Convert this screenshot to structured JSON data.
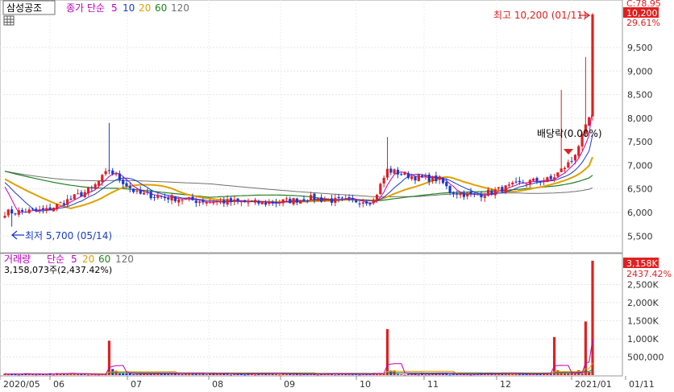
{
  "header": {
    "stock_name": "삼성공조",
    "price_ma_label": "종가 단순",
    "ma_periods": [
      "5",
      "10",
      "20",
      "60",
      "120"
    ],
    "volume_label": "거래량",
    "volume_ma_label": "단순",
    "volume_ma_periods": [
      "5",
      "20",
      "60",
      "120"
    ],
    "volume_readout": "3,158,073주(2,437.42%)"
  },
  "colors": {
    "up": "#e02020",
    "down": "#1a3cc8",
    "ma5": "#c000c0",
    "ma10": "#1a3cc8",
    "ma20": "#e0a000",
    "ma60": "#208020",
    "ma120": "#707070",
    "badge": "#e02020"
  },
  "price_axis": {
    "ticks": [
      "5,500",
      "6,000",
      "6,500",
      "7,000",
      "7,500",
      "8,000",
      "8,500",
      "9,000",
      "9,500"
    ],
    "right_top_clipped": "C:78.95",
    "last_price": "10,200",
    "change_pct": "29.61%"
  },
  "volume_axis": {
    "ticks": [
      "500,000",
      "1,000K",
      "1,500K",
      "2,000K",
      "2,500K"
    ],
    "last_volume": "3,158K",
    "change_pct": "2437.42%"
  },
  "x_axis": {
    "labels": [
      "2020/05",
      "06",
      "07",
      "08",
      "09",
      "10",
      "11",
      "12",
      "2021/01",
      "01/11"
    ]
  },
  "annotations": {
    "high": "최고 10,200 (01/11)",
    "low": "최저 5,700 (05/14)",
    "dividend": "배당락(0.00%)"
  },
  "chart_data": {
    "type": "candlestick",
    "title": "삼성공조",
    "period": "2020/05 - 2021/01/11 (daily)",
    "y_range": [
      5300,
      10200
    ],
    "volume_range": [
      0,
      3200000
    ],
    "highest": {
      "value": 10200,
      "date": "01/11"
    },
    "lowest": {
      "value": 5700,
      "date": "05/14"
    },
    "last": {
      "close": 10200,
      "change_pct": 29.61,
      "volume": 3158073,
      "volume_change_pct": 2437.42
    },
    "approx_close_path": [
      {
        "month": "2020/05",
        "close": 6000
      },
      {
        "month": "06",
        "close": 6700
      },
      {
        "month": "07",
        "close": 6250
      },
      {
        "month": "08",
        "close": 6300
      },
      {
        "month": "09",
        "close": 6350
      },
      {
        "month": "10",
        "close": 6600
      },
      {
        "month": "11",
        "close": 6350
      },
      {
        "month": "12",
        "close": 6700
      },
      {
        "month": "2021/01",
        "close": 10200
      }
    ],
    "volume_spikes": [
      {
        "month": "06",
        "volume": 950000
      },
      {
        "month": "09",
        "volume": 1270000
      },
      {
        "month": "12",
        "volume": 1050000
      },
      {
        "month": "2021/01",
        "volume": 1480000
      },
      {
        "month": "01/11",
        "volume": 3158073
      }
    ]
  }
}
